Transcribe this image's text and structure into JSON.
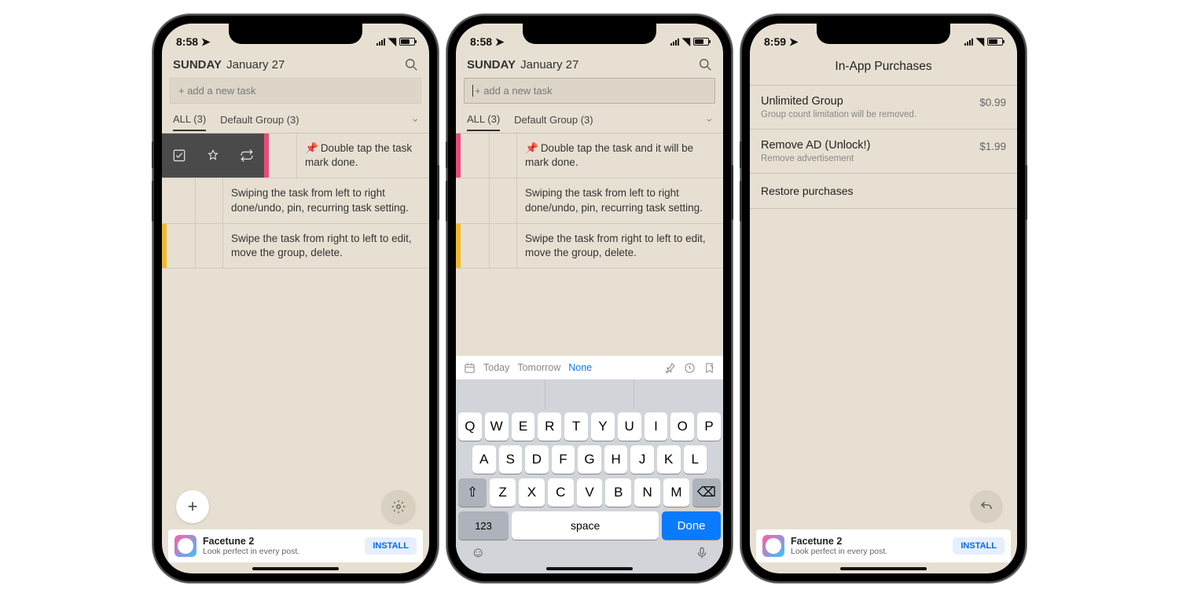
{
  "status": {
    "time_a": "8:58",
    "time_b": "8:58",
    "time_c": "8:59"
  },
  "header": {
    "day": "SUNDAY",
    "date": "January 27"
  },
  "add_task_placeholder": "+ add a new task",
  "tabs": {
    "all": "ALL (3)",
    "group": "Default Group (3)"
  },
  "tasks": [
    {
      "text": "Double tap the task and it will be mark done.",
      "text_short": "Double tap the task mark done.",
      "stripe": "pink",
      "pinned": true
    },
    {
      "text": "Swiping the task from left to right done/undo, pin, recurring task setting.",
      "stripe": "",
      "pinned": false
    },
    {
      "text": "Swipe the task from right to left to edit, move the group, delete.",
      "stripe": "yellow",
      "pinned": false
    }
  ],
  "kb_opts": {
    "today": "Today",
    "tomorrow": "Tomorrow",
    "none": "None"
  },
  "keyboard": {
    "r1": [
      "Q",
      "W",
      "E",
      "R",
      "T",
      "Y",
      "U",
      "I",
      "O",
      "P"
    ],
    "r2": [
      "A",
      "S",
      "D",
      "F",
      "G",
      "H",
      "J",
      "K",
      "L"
    ],
    "r3": [
      "Z",
      "X",
      "C",
      "V",
      "B",
      "N",
      "M"
    ],
    "num": "123",
    "space": "space",
    "done": "Done"
  },
  "iap": {
    "title": "In-App Purchases",
    "items": [
      {
        "title": "Unlimited Group",
        "sub": "Group count limitation will be removed.",
        "price": "$0.99"
      },
      {
        "title": "Remove AD (Unlock!)",
        "sub": "Remove advertisement",
        "price": "$1.99"
      }
    ],
    "restore": "Restore purchases"
  },
  "ad": {
    "title": "Facetune 2",
    "sub": "Look perfect in every post.",
    "cta": "INSTALL"
  }
}
